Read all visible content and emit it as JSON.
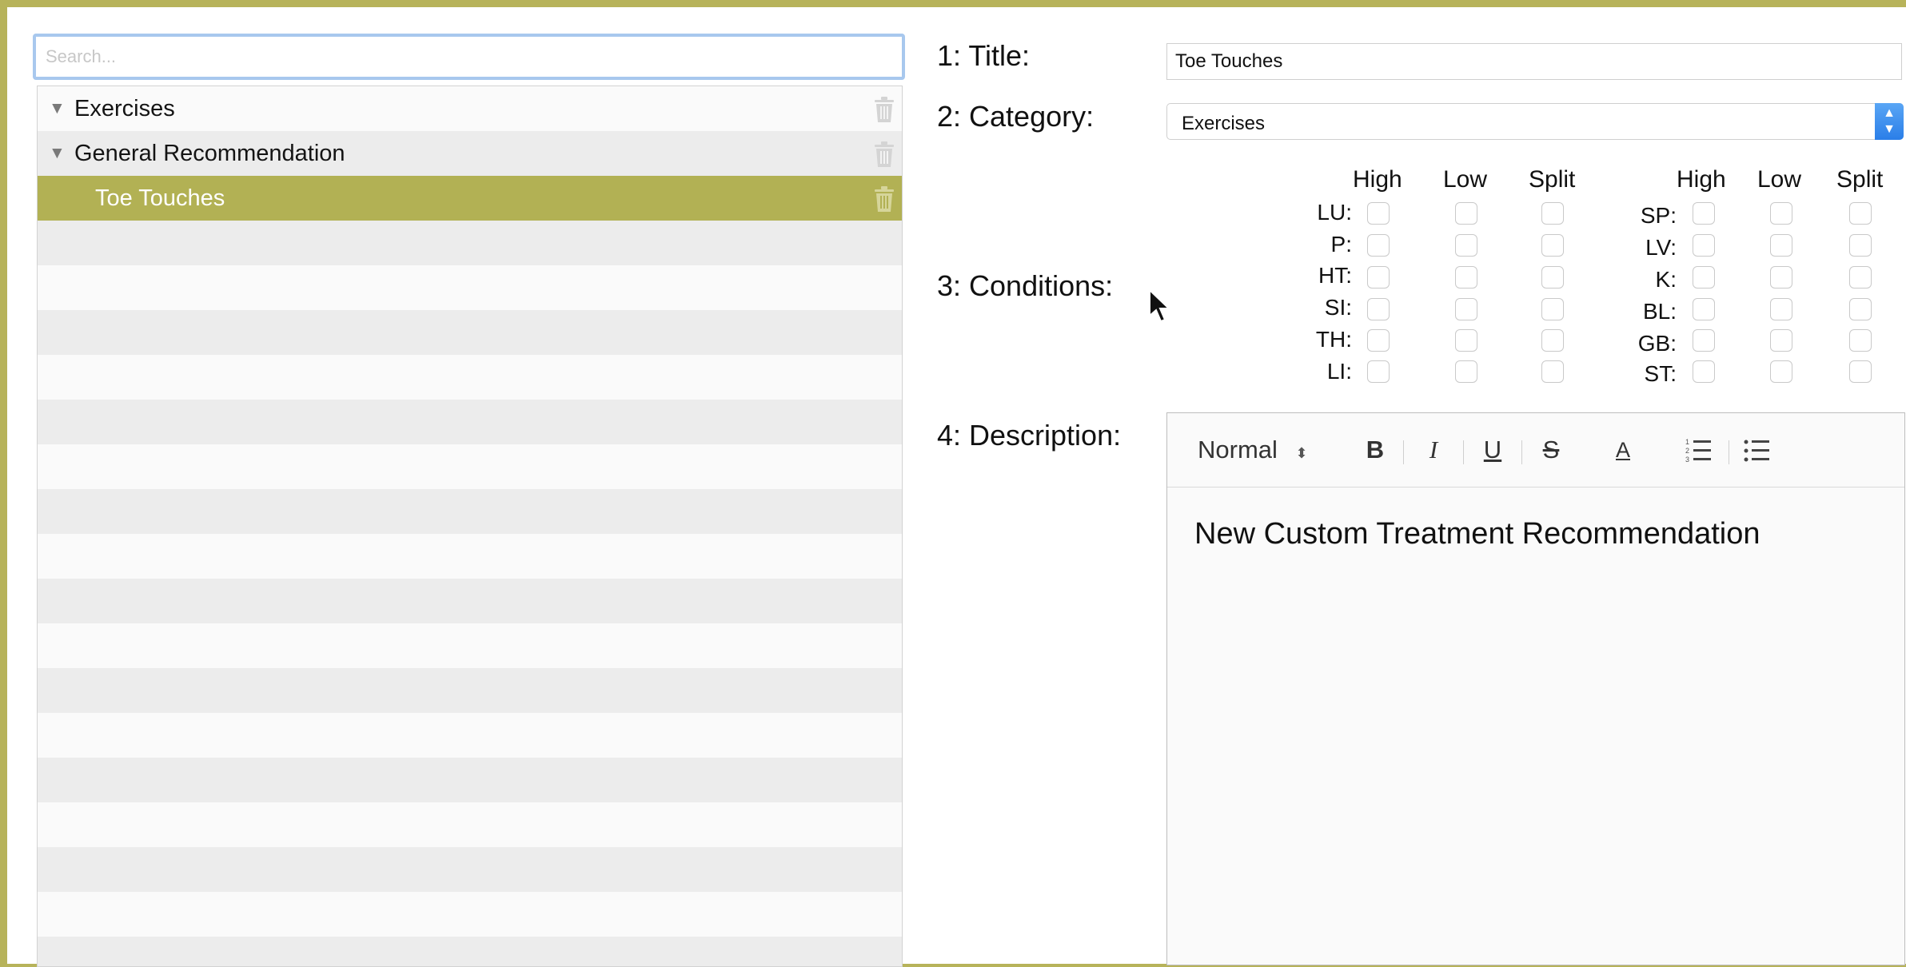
{
  "search": {
    "placeholder": "Search..."
  },
  "tree": {
    "items": [
      {
        "label": "Exercises"
      },
      {
        "label": "General Recommendation"
      },
      {
        "label": "Toe Touches"
      }
    ]
  },
  "form": {
    "title_label": "1: Title:",
    "title_value": "Toe Touches",
    "category_label": "2: Category:",
    "category_value": "Exercises",
    "conditions_label": "3: Conditions:",
    "description_label": "4: Description:"
  },
  "conditions": {
    "columns": [
      "High",
      "Low",
      "Split"
    ],
    "left_rows": [
      "LU:",
      "P:",
      "HT:",
      "SI:",
      "TH:",
      "LI:"
    ],
    "right_rows": [
      "SP:",
      "LV:",
      "K:",
      "BL:",
      "GB:",
      "ST:"
    ]
  },
  "editor": {
    "style_select": "Normal",
    "bold": "B",
    "italic": "I",
    "underline": "U",
    "strike": "S",
    "text_color": "A",
    "body": "New Custom Treatment Recommendation"
  },
  "colors": {
    "accent": "#b2b154",
    "frame": "#b7b35a",
    "focus": "#a8c8ee",
    "select_arrow": "#2a7ee8"
  }
}
